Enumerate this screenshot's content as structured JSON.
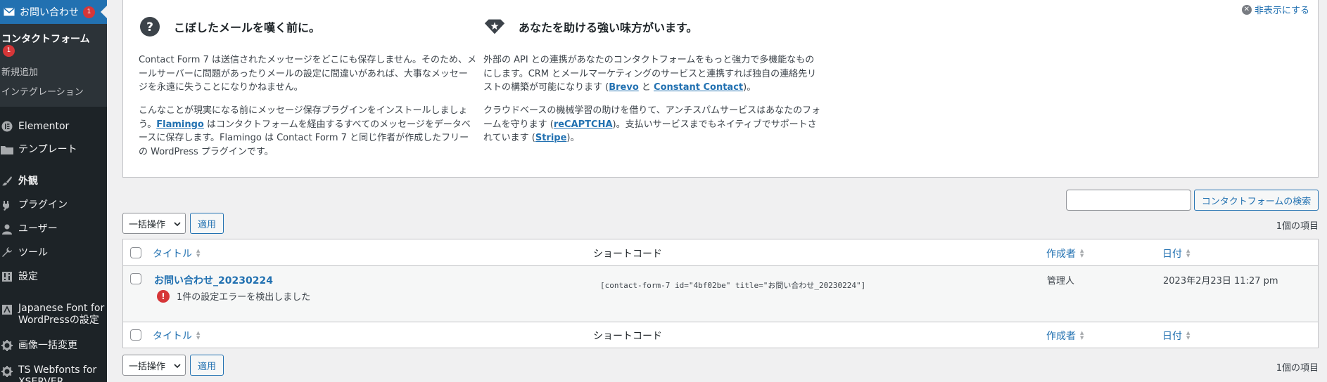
{
  "sidebar": {
    "active_menu": {
      "label": "お問い合わせ",
      "badge": "1",
      "icon": "envelope-icon"
    },
    "submenu": [
      {
        "label": "コンタクトフォーム",
        "badge": "1",
        "current": true
      },
      {
        "label": "新規追加"
      },
      {
        "label": "インテグレーション"
      }
    ],
    "menu_items": [
      {
        "label": "Elementor",
        "icon": "elementor-icon"
      },
      {
        "label": "テンプレート",
        "icon": "folder-icon"
      },
      {
        "label": "外観",
        "icon": "brush-icon"
      },
      {
        "label": "プラグイン",
        "icon": "plugin-icon"
      },
      {
        "label": "ユーザー",
        "icon": "user-icon"
      },
      {
        "label": "ツール",
        "icon": "wrench-icon"
      },
      {
        "label": "設定",
        "icon": "settings-icon"
      },
      {
        "label_line1": "Japanese Font for",
        "label_line2": "WordPressの設定",
        "icon": "font-icon"
      },
      {
        "label": "画像一括変更",
        "icon": "gear-icon"
      },
      {
        "label_line1": "TS Webfonts for",
        "label_line2": "XSERVER",
        "icon": "gear-icon"
      }
    ]
  },
  "notice": {
    "dismiss_label": "非表示にする",
    "left": {
      "heading": "こぼしたメールを嘆く前に。",
      "icon": "question-icon",
      "p1": "Contact Form 7 は送信されたメッセージをどこにも保存しません。そのため、メールサーバーに問題があったりメールの設定に間違いがあれば、大事なメッセージを永遠に失うことになりかねません。",
      "p2_before": "こんなことが現実になる前にメッセージ保存プラグインをインストールしましょう。",
      "p2_link": "Flamingo",
      "p2_after": " はコンタクトフォームを経由するすべてのメッセージをデータベースに保存します。Flamingo は Contact Form 7 と同じ作者が作成したフリーの WordPress プラグインです。"
    },
    "right": {
      "heading": "あなたを助ける強い味方がいます。",
      "icon": "diamond-star-icon",
      "p1_before": "外部の API との連携があなたのコンタクトフォームをもっと強力で多機能なものにします。CRM とメールマーケティングのサービスと連携すれば独自の連絡先リストの構築が可能になります (",
      "p1_link1": "Brevo",
      "p1_mid": " と ",
      "p1_link2": "Constant Contact",
      "p1_after": ")。",
      "p2_before": "クラウドベースの機械学習の助けを借りて、アンチスパムサービスはあなたのフォームを守ります (",
      "p2_link1": "reCAPTCHA",
      "p2_mid": ")。支払いサービスまでもネイティブでサポートされています (",
      "p2_link2": "Stripe",
      "p2_after": ")。"
    }
  },
  "search": {
    "value": "",
    "button_label": "コンタクトフォームの検索"
  },
  "bulk": {
    "select_label": "一括操作",
    "apply_label": "適用"
  },
  "item_count": "1個の項目",
  "table": {
    "columns": {
      "title": "タイトル",
      "shortcode": "ショートコード",
      "author": "作成者",
      "date": "日付"
    },
    "rows": [
      {
        "title": "お問い合わせ_20230224",
        "error": "1件の設定エラーを検出しました",
        "shortcode": "[contact-form-7 id=\"4bf02be\" title=\"お問い合わせ_20230224\"]",
        "author": "管理人",
        "date": "2023年2月23日 11:27 pm"
      }
    ]
  },
  "colors": {
    "accent": "#2271b1",
    "sidebar_bg": "#1d2327",
    "submenu_bg": "#2c3338",
    "error": "#d63638"
  }
}
